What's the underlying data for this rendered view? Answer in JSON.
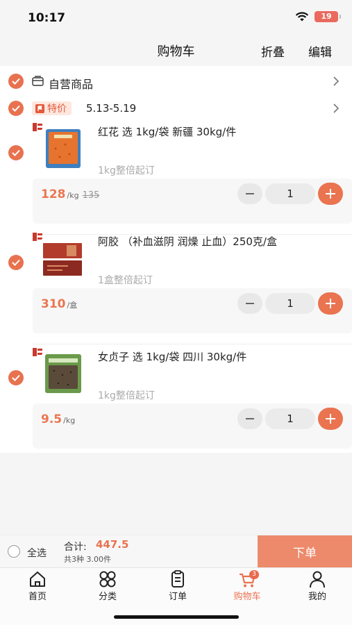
{
  "status_bar": {
    "time": "10:17",
    "battery": "19"
  },
  "nav": {
    "title": "购物车",
    "fold_label": "折叠",
    "edit_label": "编辑"
  },
  "store_group": {
    "name": "自营商品"
  },
  "promo_group": {
    "tag": "特价",
    "date_range": "5.13-5.19"
  },
  "items": [
    {
      "name": "红花 选 1kg/袋 新疆 30kg/件",
      "min_order": "1kg整倍起订",
      "price": "128",
      "unit": "/kg",
      "original_price": "135",
      "qty": "1"
    },
    {
      "name": "阿胶 （补血滋阴 润燥 止血）250克/盒",
      "min_order": "1盒整倍起订",
      "price": "310",
      "unit": "/盒",
      "original_price": "",
      "qty": "1"
    },
    {
      "name": "女贞子 选 1kg/袋 四川 30kg/件",
      "min_order": "1kg整倍起订",
      "price": "9.5",
      "unit": "/kg",
      "original_price": "",
      "qty": "1"
    }
  ],
  "footer": {
    "select_all": "全选",
    "total_label": "合计:",
    "total_value": "447.5",
    "summary": "共3种 3.00件",
    "order_button": "下单"
  },
  "tabs": [
    {
      "label": "首页",
      "icon": "home-icon"
    },
    {
      "label": "分类",
      "icon": "category-icon"
    },
    {
      "label": "订单",
      "icon": "order-icon"
    },
    {
      "label": "购物车",
      "icon": "cart-icon",
      "badge": "3",
      "active": true
    },
    {
      "label": "我的",
      "icon": "profile-icon"
    }
  ],
  "colors": {
    "accent": "#e8724f",
    "order_button": "#ec8a6b",
    "price": "#ea7751"
  }
}
